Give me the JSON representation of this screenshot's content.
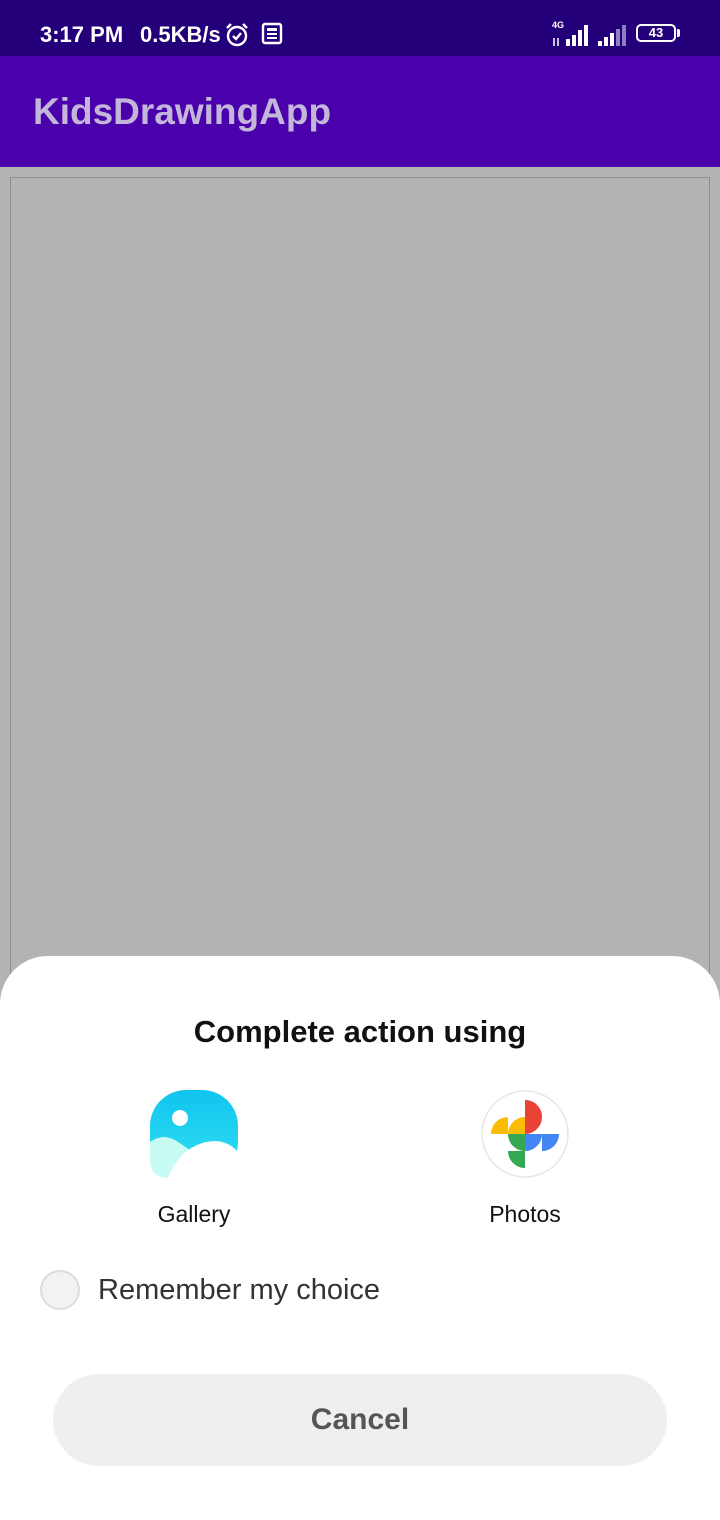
{
  "status_bar": {
    "time": "3:17 PM",
    "speed": "0.5KB/s",
    "network_type": "4G",
    "battery_level": "43",
    "icons": [
      "alarm-icon",
      "news-icon",
      "signal-icon",
      "signal-icon",
      "battery-icon"
    ]
  },
  "app_bar": {
    "title": "KidsDrawingApp"
  },
  "chooser": {
    "title": "Complete action using",
    "apps": [
      {
        "label": "Gallery",
        "icon": "gallery-icon"
      },
      {
        "label": "Photos",
        "icon": "photos-icon"
      }
    ],
    "remember_label": "Remember my choice",
    "remember_checked": false,
    "cancel_label": "Cancel"
  },
  "colors": {
    "status_bar": "#23007a",
    "app_bar": "#4a00aa",
    "app_title": "#c3b6da",
    "canvas": "#b3b3b3",
    "sheet": "#ffffff",
    "cancel_bg": "#efefef"
  }
}
